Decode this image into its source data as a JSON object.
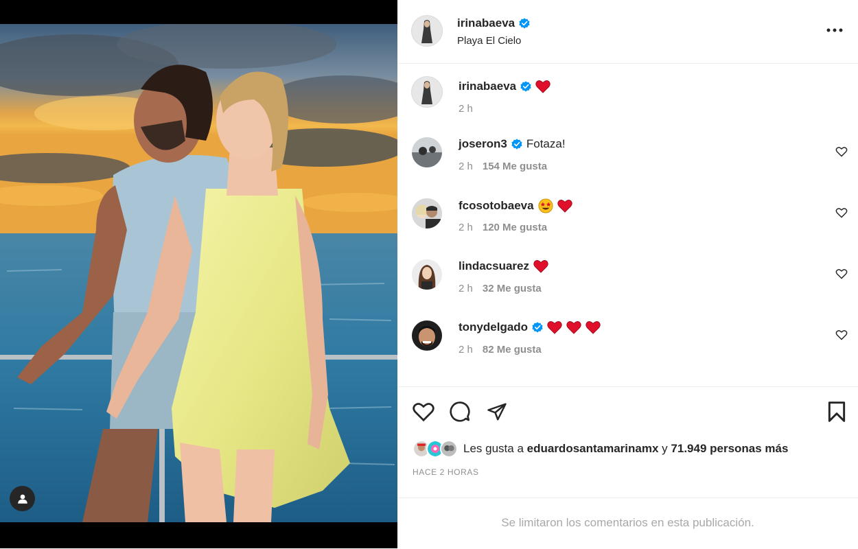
{
  "post": {
    "author": "irinabaeva",
    "author_verified": true,
    "location": "Playa El Cielo",
    "more_icon": "more-options-icon"
  },
  "caption": {
    "user": "irinabaeva",
    "verified": true,
    "emojis": [
      "red-heart"
    ],
    "time": "2 h"
  },
  "comments": [
    {
      "user": "joseron3",
      "verified": true,
      "text": "Fotaza!",
      "emojis": [],
      "time": "2 h",
      "likes": "154 Me gusta"
    },
    {
      "user": "fcosotobaeva",
      "verified": false,
      "text": "",
      "emojis": [
        "star-struck",
        "red-heart"
      ],
      "time": "2 h",
      "likes": "120 Me gusta"
    },
    {
      "user": "lindacsuarez",
      "verified": false,
      "text": "",
      "emojis": [
        "red-heart"
      ],
      "time": "2 h",
      "likes": "32 Me gusta"
    },
    {
      "user": "tonydelgado",
      "verified": true,
      "text": "",
      "emojis": [
        "red-heart",
        "red-heart",
        "red-heart"
      ],
      "time": "2 h",
      "likes": "82 Me gusta"
    }
  ],
  "actions": {
    "icons": [
      "heart-icon",
      "comment-icon",
      "share-icon",
      "bookmark-icon"
    ]
  },
  "likes_summary": {
    "prefix": "Les gusta a",
    "user": "eduardosantamarinamx",
    "connector": "y",
    "others": "71.949 personas más"
  },
  "posted_ago": "HACE 2 HORAS",
  "comments_limited": "Se limitaron los comentarios en esta publicación.",
  "colors": {
    "verified_blue": "#0095f6",
    "heart_red": "#e0102b",
    "text_primary": "#262626",
    "text_secondary": "#8e8e8e",
    "divider": "#efefef"
  }
}
